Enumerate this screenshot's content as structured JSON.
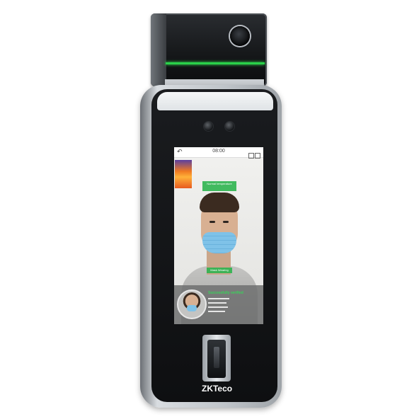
{
  "device": {
    "brand_logo": "ZKTeco",
    "accent_stripe_color": "#2ad14a",
    "screen": {
      "clock": "08:00",
      "back_icon": "back-arrow-icon",
      "temperature_label": "Normal temperature",
      "mask_label": "Mask Wearing",
      "verification_title": "Successfully verified"
    }
  }
}
